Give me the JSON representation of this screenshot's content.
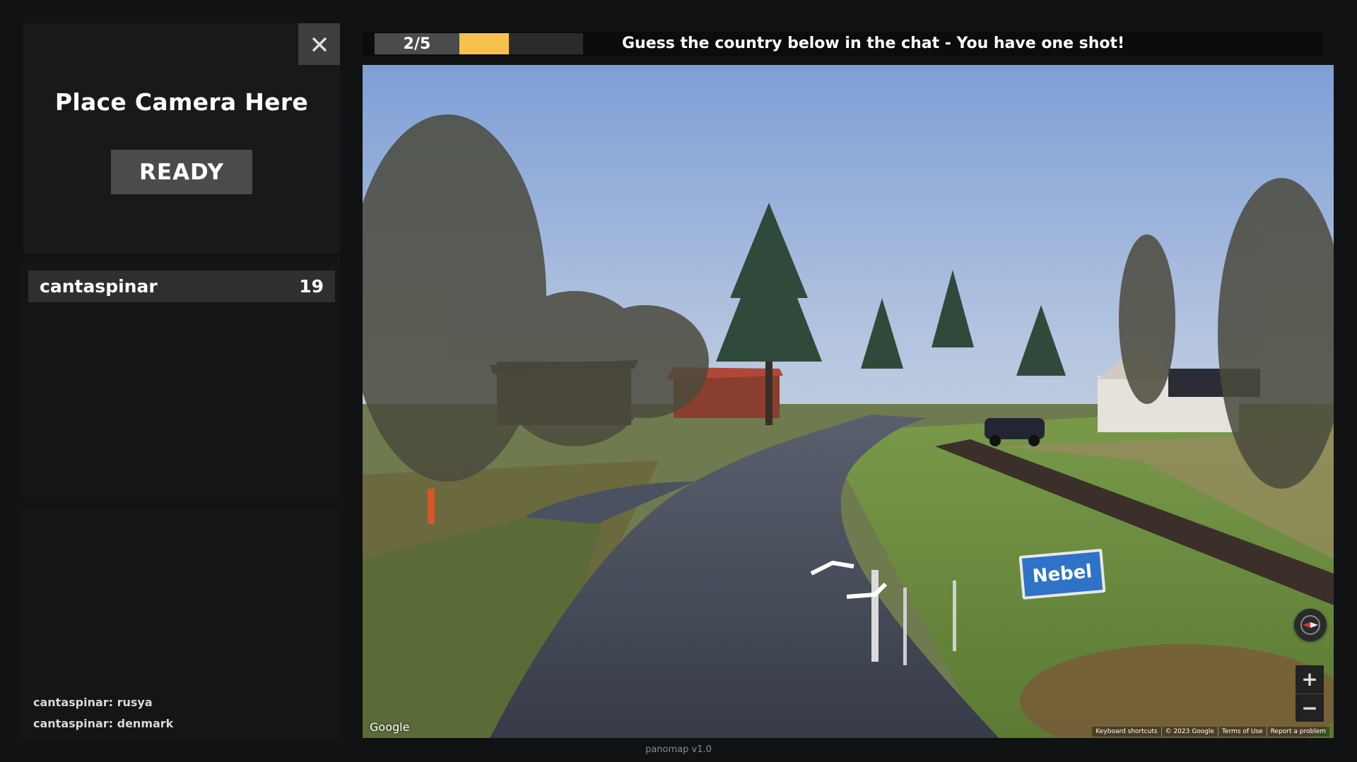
{
  "sidebar": {
    "close_icon": "close-icon",
    "camera_title": "Place Camera Here",
    "ready_label": "READY",
    "leaderboard": [
      {
        "name": "cantaspinar",
        "score": "19"
      }
    ],
    "chat": [
      "cantaspinar: rusya",
      "cantaspinar: denmark"
    ]
  },
  "game": {
    "round": "2/5",
    "progress": 0.4,
    "instruction": "Guess the country below in the chat - You have one shot!"
  },
  "panorama": {
    "place_sign": "Nebel",
    "google_logo": "Google",
    "footer_links": [
      "Keyboard shortcuts",
      "© 2023 Google",
      "Terms of Use",
      "Report a problem"
    ],
    "zoom_in": "+",
    "zoom_out": "−",
    "compass_icon": "compass-icon",
    "nav_icon": "navigation-arrows-icon"
  },
  "footer": {
    "version": "panomap v1.0"
  },
  "colors": {
    "accent": "#f7c24b",
    "sign": "#2e73c7"
  }
}
